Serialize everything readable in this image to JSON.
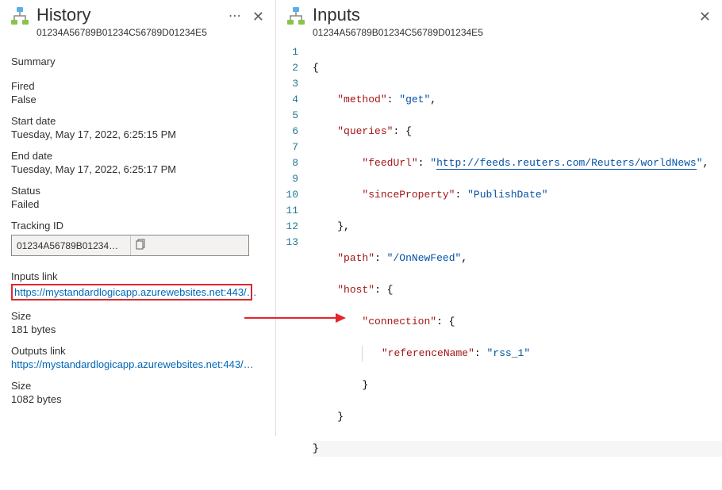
{
  "left": {
    "title": "History",
    "subtitle": "01234A56789B01234C56789D01234E5",
    "summary_label": "Summary",
    "fired_label": "Fired",
    "fired_value": "False",
    "start_label": "Start date",
    "start_value": "Tuesday, May 17, 2022, 6:25:15 PM",
    "end_label": "End date",
    "end_value": "Tuesday, May 17, 2022, 6:25:17 PM",
    "status_label": "Status",
    "status_value": "Failed",
    "tracking_label": "Tracking ID",
    "tracking_value": "01234A56789B01234C56789D01234E5",
    "inputs_link_label": "Inputs link",
    "inputs_link_value": "https://mystandardlogicapp.azurewebsites.net:443/…",
    "inputs_size_label": "Size",
    "inputs_size_value": "181 bytes",
    "outputs_link_label": "Outputs link",
    "outputs_link_value": "https://mystandardlogicapp.azurewebsites.net:443/…",
    "outputs_size_label": "Size",
    "outputs_size_value": "1082 bytes"
  },
  "right": {
    "title": "Inputs",
    "subtitle": "01234A56789B01234C56789D01234E5",
    "code": {
      "method_key": "method",
      "method_val": "get",
      "queries_key": "queries",
      "feedUrl_key": "feedUrl",
      "feedUrl_val": "http://feeds.reuters.com/Reuters/worldNews",
      "sinceProperty_key": "sinceProperty",
      "sinceProperty_val": "PublishDate",
      "path_key": "path",
      "path_val": "/OnNewFeed",
      "host_key": "host",
      "connection_key": "connection",
      "referenceName_key": "referenceName",
      "referenceName_val": "rss_1"
    }
  }
}
